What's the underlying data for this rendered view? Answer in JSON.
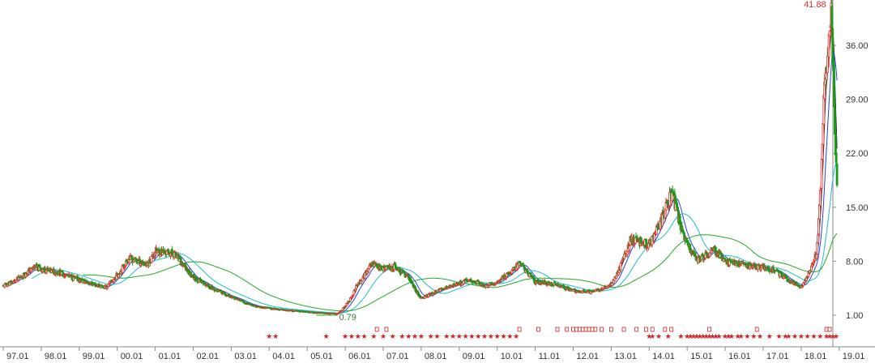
{
  "chart_data": {
    "type": "candlestick",
    "title": "",
    "xlabel": "",
    "ylabel": "",
    "ylim": [
      -2.2,
      44
    ],
    "y_ticks": [
      1.0,
      8.0,
      15.0,
      22.0,
      29.0,
      36.0
    ],
    "y_tick_labels": [
      "1.00",
      "8.00",
      "15.00",
      "22.00",
      "29.00",
      "36.00"
    ],
    "x_ticks": [
      "97.01",
      "98.01",
      "99.01",
      "00.01",
      "01.01",
      "02.01",
      "03.01",
      "04.01",
      "05.01",
      "06.01",
      "07.01",
      "08.01",
      "09.01",
      "10.01",
      "11.01",
      "12.01",
      "13.01",
      "14.01",
      "15.01",
      "16.01",
      "17.01",
      "18.01",
      "19.01"
    ],
    "grid": false,
    "legend": "none",
    "colors": {
      "up": "#e03030",
      "down": "#1a9a1a",
      "ma_short": "#222222",
      "ma_mid": "#2244dd",
      "ma_long": "#22bbcc",
      "ma_longest": "#22aa22",
      "marker": "#d02020",
      "axis": "#888888"
    },
    "price_anchors": {
      "t": [
        0,
        0.3,
        0.8,
        1.5,
        2.1,
        2.7,
        3.3,
        3.8,
        4.0,
        4.5,
        5.0,
        5.5,
        6.1,
        6.7,
        7.2,
        7.8,
        8.3,
        8.8,
        9.0,
        9.3,
        9.7,
        10.0,
        10.3,
        10.7,
        11.0,
        11.5,
        11.8,
        12.3,
        12.7,
        13.0,
        13.6,
        14.0,
        14.5,
        15.0,
        15.5,
        16.0,
        16.5,
        17.0,
        17.6,
        18.0,
        18.3,
        18.7,
        19.0,
        19.5,
        20.0,
        20.3,
        20.7,
        21.0,
        21.4,
        21.6,
        21.8,
        21.95
      ],
      "price": [
        4.8,
        5.4,
        7.2,
        6.5,
        5.4,
        4.6,
        8.4,
        7.6,
        9.3,
        9.0,
        6.0,
        4.5,
        3.2,
        2.1,
        1.8,
        1.5,
        1.3,
        1.2,
        2.2,
        4.8,
        7.8,
        7.0,
        7.3,
        5.8,
        3.2,
        4.3,
        4.8,
        5.6,
        4.8,
        5.3,
        7.8,
        5.4,
        5.0,
        4.2,
        4.0,
        5.0,
        10.8,
        10.2,
        17.0,
        10.0,
        8.2,
        9.5,
        8.0,
        7.6,
        7.2,
        6.9,
        5.4,
        4.6,
        9.0,
        30.0,
        41.88,
        17.0
      ]
    },
    "annotations": [
      {
        "text": "41.88",
        "x": "18.10",
        "y": 41.88
      },
      {
        "text": "0.79",
        "x": "05.09",
        "y": 0.79
      }
    ],
    "markers": {
      "star": [
        "04.01",
        "04.03",
        "05.07",
        "06.01",
        "06.03",
        "06.05",
        "06.07",
        "06.10",
        "07.01",
        "07.04",
        "07.07",
        "07.09",
        "07.11",
        "08.01",
        "08.04",
        "08.06",
        "08.09",
        "08.11",
        "09.01",
        "09.03",
        "09.05",
        "09.07",
        "09.09",
        "09.11",
        "10.01",
        "10.03",
        "10.05",
        "10.07",
        "14.01",
        "14.02",
        "14.04",
        "14.07",
        "14.11",
        "15.01",
        "15.02",
        "15.03",
        "15.04",
        "15.05",
        "15.06",
        "15.07",
        "15.08",
        "15.09",
        "15.10",
        "15.11",
        "16.01",
        "16.02",
        "16.03",
        "16.05",
        "16.06",
        "16.08",
        "16.10",
        "16.12",
        "17.03",
        "17.06",
        "17.08",
        "17.09",
        "17.11",
        "18.01",
        "18.03",
        "18.05",
        "18.07",
        "18.09",
        "18.10",
        "18.11",
        "18.12"
      ],
      "r": [
        "06.11",
        "07.02",
        "10.08",
        "11.02",
        "11.08",
        "11.11",
        "12.01",
        "12.02",
        "12.03",
        "12.04",
        "12.05",
        "12.06",
        "12.07",
        "12.08",
        "12.10",
        "13.01",
        "13.05",
        "13.09",
        "13.12",
        "14.02",
        "14.06",
        "14.08",
        "15.08",
        "16.11",
        "18.09",
        "18.10"
      ]
    }
  }
}
